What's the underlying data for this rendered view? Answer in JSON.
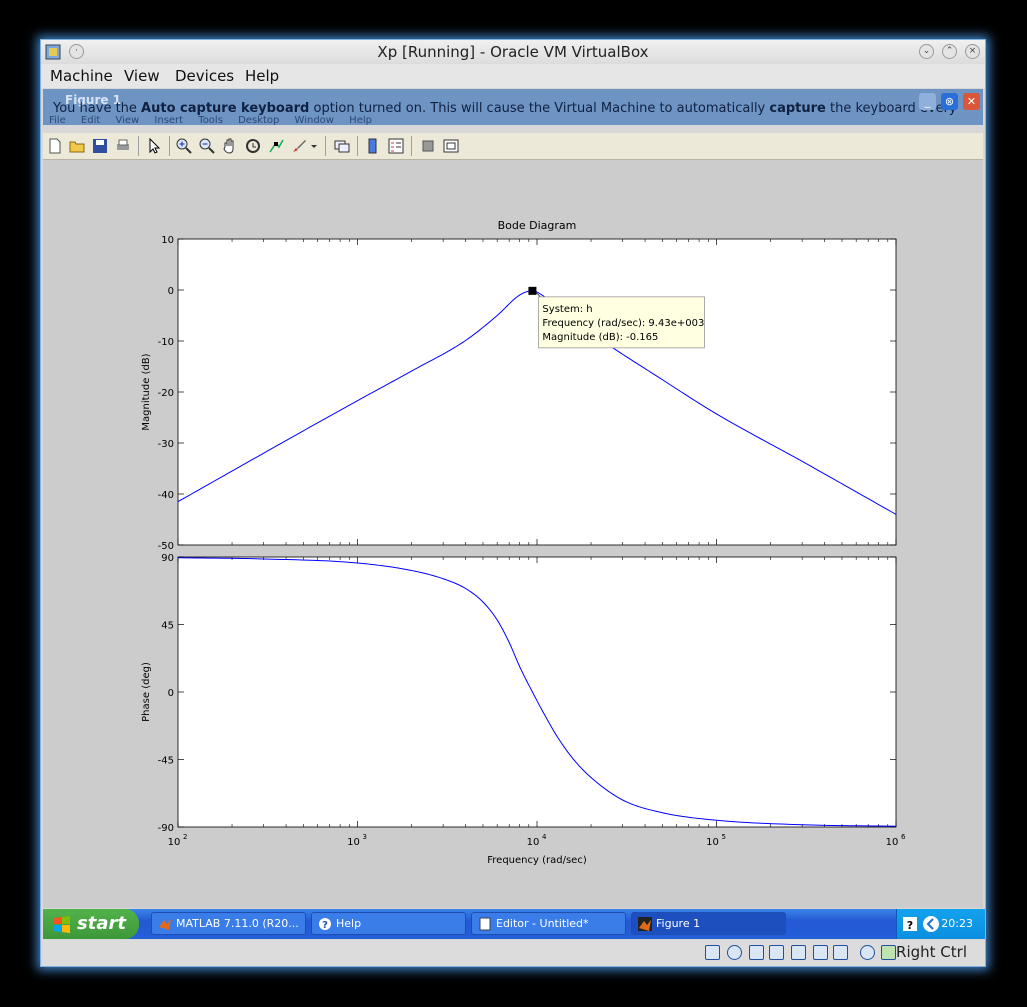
{
  "window": {
    "title": "Xp [Running] - Oracle VM VirtualBox"
  },
  "menu": [
    "Machine",
    "View",
    "Devices",
    "Help"
  ],
  "notice": {
    "ghost_title": "Figure 1",
    "message_parts": [
      "You have the ",
      "Auto capture keyboard",
      " option turned on. This will cause the Virtual Machine to automatically ",
      "capture",
      " the keyboard every"
    ],
    "ghost_menu": [
      "File",
      "Edit",
      "View",
      "Insert",
      "Tools",
      "Desktop",
      "Window",
      "Help"
    ]
  },
  "figure": {
    "title": "Bode Diagram",
    "mag_ylabel": "Magnitude (dB)",
    "phase_ylabel": "Phase (deg)",
    "xlabel": "Frequency  (rad/sec)",
    "datatip": {
      "line1": "System: h",
      "line2": "Frequency (rad/sec): 9.43e+003",
      "line3": "Magnitude (dB): -0.165"
    }
  },
  "chart_data": {
    "type": "line",
    "title": "Bode Diagram",
    "xlabel": "Frequency  (rad/sec)",
    "xscale": "log",
    "xlim": [
      100,
      1000000
    ],
    "xticks": [
      "10^2",
      "10^3",
      "10^4",
      "10^5",
      "10^6"
    ],
    "panels": [
      {
        "name": "magnitude",
        "ylabel": "Magnitude (dB)",
        "ylim": [
          -50,
          10
        ],
        "yticks": [
          10,
          0,
          -10,
          -20,
          -30,
          -40,
          -50
        ],
        "x": [
          100,
          200,
          500,
          1000,
          2000,
          4000,
          6000,
          8000,
          9430,
          11000,
          15000,
          20000,
          50000,
          100000,
          300000,
          1000000
        ],
        "y": [
          -41.5,
          -35.5,
          -27.6,
          -21.7,
          -15.9,
          -9.9,
          -5.0,
          -1.0,
          -0.165,
          -1.3,
          -5.0,
          -8.4,
          -17.6,
          -24.3,
          -33.6,
          -44.0
        ]
      },
      {
        "name": "phase",
        "ylabel": "Phase (deg)",
        "ylim": [
          -90,
          90
        ],
        "yticks": [
          90,
          45,
          0,
          -45,
          -90
        ],
        "x": [
          100,
          300,
          1000,
          2000,
          3000,
          4000,
          5000,
          6000,
          7000,
          8000,
          9430,
          11000,
          13000,
          16000,
          20000,
          30000,
          50000,
          100000,
          300000,
          1000000
        ],
        "y": [
          89.5,
          88.7,
          86.0,
          81.0,
          75.5,
          69.0,
          60.0,
          48.0,
          33.0,
          17.0,
          0.0,
          -15.0,
          -30.0,
          -45.0,
          -57.0,
          -72.0,
          -80.5,
          -85.5,
          -88.5,
          -89.5
        ]
      }
    ],
    "datatip": {
      "system": "h",
      "frequency": 9430,
      "magnitude_db": -0.165
    }
  },
  "taskbar": {
    "start_label": "start",
    "tasks": [
      {
        "label": "MATLAB  7.11.0 (R20..."
      },
      {
        "label": "Help"
      },
      {
        "label": "Editor - Untitled*"
      },
      {
        "label": "Figure 1"
      }
    ],
    "clock": "20:23"
  },
  "status": {
    "host_key": "Right Ctrl"
  },
  "colors": {
    "plot_line": "#0000ff",
    "taskbar": "#245fd8",
    "start": "#3d9838",
    "notice": "#6e94c4"
  }
}
